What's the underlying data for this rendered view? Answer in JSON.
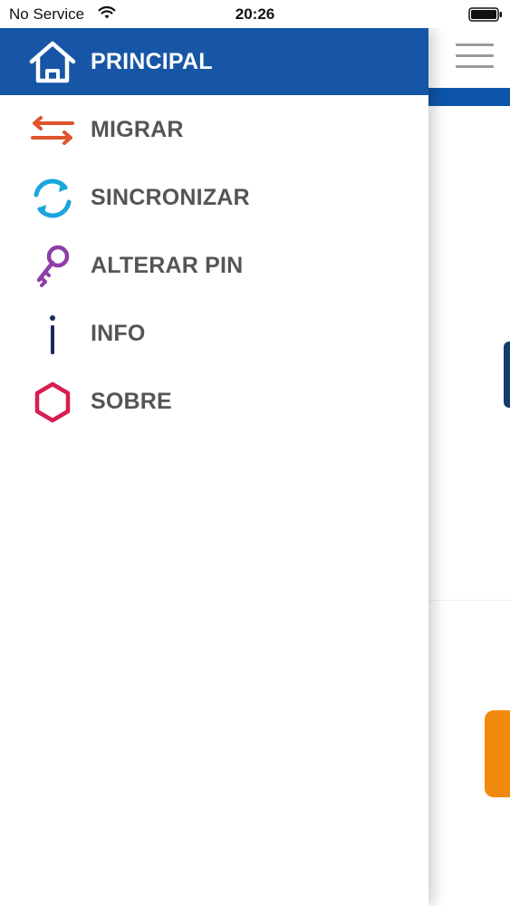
{
  "status_bar": {
    "carrier": "No Service",
    "time": "20:26"
  },
  "menu": {
    "items": [
      {
        "label": "PRINCIPAL",
        "icon": "home-icon",
        "active": true
      },
      {
        "label": "MIGRAR",
        "icon": "swap-arrows-icon",
        "active": false
      },
      {
        "label": "SINCRONIZAR",
        "icon": "sync-icon",
        "active": false
      },
      {
        "label": "ALTERAR PIN",
        "icon": "key-icon",
        "active": false
      },
      {
        "label": "INFO",
        "icon": "info-icon",
        "active": false
      },
      {
        "label": "SOBRE",
        "icon": "hexagon-icon",
        "active": false
      }
    ]
  },
  "colors": {
    "active_background": "#1756a7",
    "menu_text": "#555555",
    "migrar_icon": "#e0542c",
    "sync_icon": "#1aa5dc",
    "key_icon": "#8e3da6",
    "info_icon": "#1d2a5c",
    "hexagon_icon": "#d81e4f",
    "orange_button": "#f2890f"
  }
}
